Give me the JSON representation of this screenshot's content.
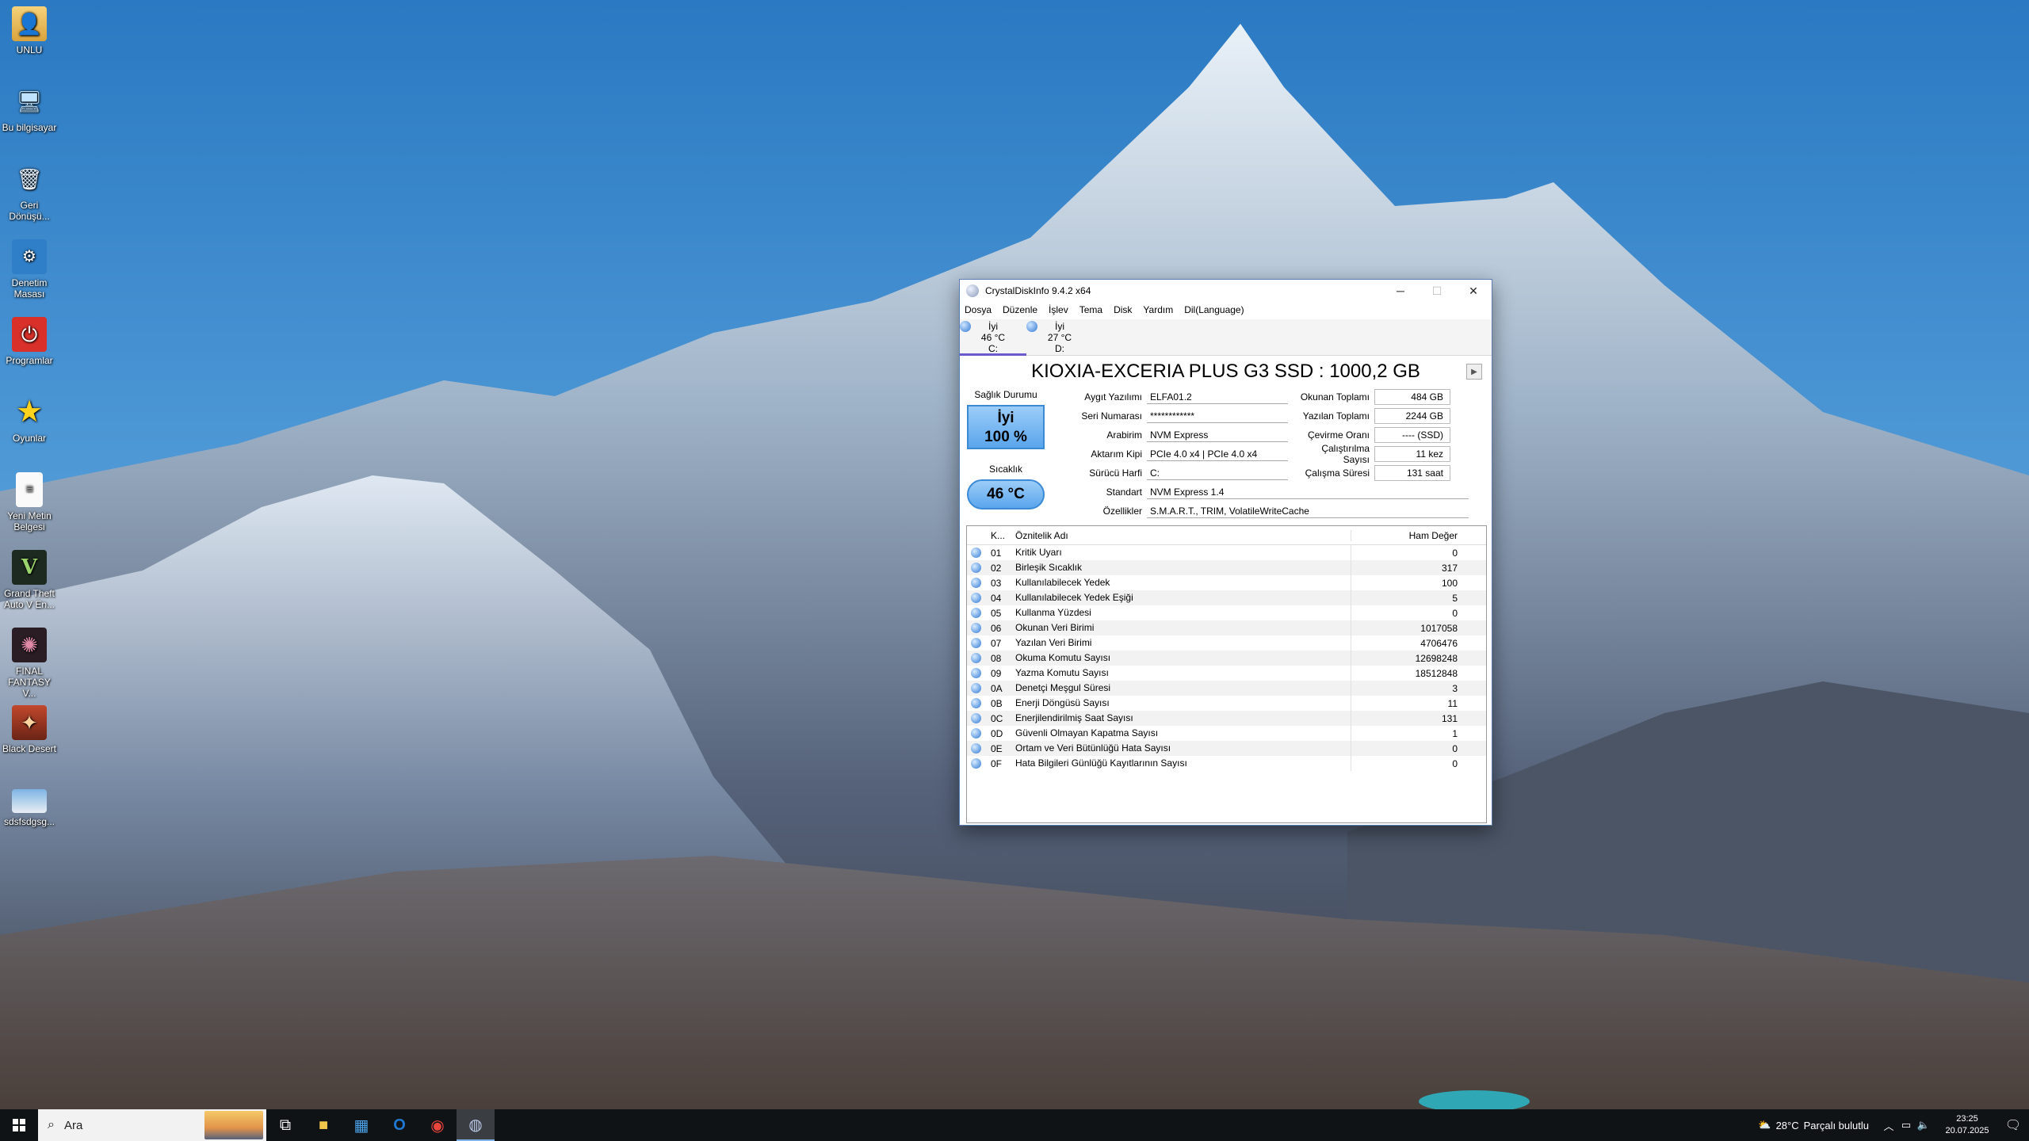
{
  "desktop": {
    "icons": [
      {
        "label": "UNLU",
        "icon": "user-folder-icon"
      },
      {
        "label": "Bu bilgisayar",
        "icon": "computer-icon"
      },
      {
        "label": "Geri Dönüşü...",
        "icon": "recycle-bin-icon"
      },
      {
        "label": "Denetim Masası",
        "icon": "control-panel-icon"
      },
      {
        "label": "Programlar",
        "icon": "power-icon"
      },
      {
        "label": "Oyunlar",
        "icon": "star-icon"
      },
      {
        "label": "Yeni Metin Belgesi",
        "icon": "text-document-icon"
      },
      {
        "label": "Grand Theft Auto V En...",
        "icon": "gta-v-icon"
      },
      {
        "label": "FINAL FANTASY V...",
        "icon": "final-fantasy-icon"
      },
      {
        "label": "Black Desert",
        "icon": "black-desert-icon"
      },
      {
        "label": "sdsfsdgsg...",
        "icon": "image-file-icon"
      }
    ]
  },
  "window": {
    "title": "CrystalDiskInfo 9.4.2 x64",
    "minimize": "─",
    "maximize": "☐",
    "close": "✕",
    "menu": [
      "Dosya",
      "Düzenle",
      "İşlev",
      "Tema",
      "Disk",
      "Yardım",
      "Dil(Language)"
    ],
    "disks": [
      {
        "status": "İyi",
        "temp": "46 °C",
        "letter": "C:"
      },
      {
        "status": "İyi",
        "temp": "27 °C",
        "letter": "D:"
      }
    ],
    "model": "KIOXIA-EXCERIA PLUS G3 SSD : 1000,2 GB",
    "next_arrow": "▶",
    "health": {
      "label": "Sağlık Durumu",
      "status": "İyi",
      "percent": "100 %"
    },
    "temperature": {
      "label": "Sıcaklık",
      "value": "46 °C"
    },
    "info": {
      "firmware": {
        "label": "Aygıt Yazılımı",
        "value": "ELFA01.2"
      },
      "serial": {
        "label": "Seri Numarası",
        "value": "************"
      },
      "interface": {
        "label": "Arabirim",
        "value": "NVM Express"
      },
      "transfer": {
        "label": "Aktarım Kipi",
        "value": "PCIe 4.0 x4 | PCIe 4.0 x4"
      },
      "drive_letter": {
        "label": "Sürücü Harfi",
        "value": "C:"
      },
      "standard": {
        "label": "Standart",
        "value": "NVM Express 1.4"
      },
      "features": {
        "label": "Özellikler",
        "value": "S.M.A.R.T., TRIM, VolatileWriteCache"
      },
      "host_reads": {
        "label": "Okunan Toplamı",
        "value": "484 GB"
      },
      "host_writes": {
        "label": "Yazılan Toplamı",
        "value": "2244 GB"
      },
      "rotation": {
        "label": "Çevirme Oranı",
        "value": "---- (SSD)"
      },
      "power_on_count": {
        "label": "Çalıştırılma Sayısı",
        "value": "11 kez"
      },
      "power_on_hours": {
        "label": "Çalışma Süresi",
        "value": "131 saat"
      }
    },
    "smart": {
      "columns": {
        "id": "K...",
        "name": "Öznitelik Adı",
        "raw": "Ham Değer"
      },
      "rows": [
        {
          "id": "01",
          "name": "Kritik Uyarı",
          "raw": "0"
        },
        {
          "id": "02",
          "name": "Birleşik Sıcaklık",
          "raw": "317"
        },
        {
          "id": "03",
          "name": "Kullanılabilecek Yedek",
          "raw": "100"
        },
        {
          "id": "04",
          "name": "Kullanılabilecek Yedek Eşiği",
          "raw": "5"
        },
        {
          "id": "05",
          "name": "Kullanma Yüzdesi",
          "raw": "0"
        },
        {
          "id": "06",
          "name": "Okunan Veri Birimi",
          "raw": "1017058"
        },
        {
          "id": "07",
          "name": "Yazılan Veri Birimi",
          "raw": "4706476"
        },
        {
          "id": "08",
          "name": "Okuma Komutu Sayısı",
          "raw": "12698248"
        },
        {
          "id": "09",
          "name": "Yazma Komutu Sayısı",
          "raw": "18512848"
        },
        {
          "id": "0A",
          "name": "Denetçi Meşgul Süresi",
          "raw": "3"
        },
        {
          "id": "0B",
          "name": "Enerji Döngüsü Sayısı",
          "raw": "11"
        },
        {
          "id": "0C",
          "name": "Enerjilendirilmiş Saat Sayısı",
          "raw": "131"
        },
        {
          "id": "0D",
          "name": "Güvenli Olmayan Kapatma Sayısı",
          "raw": "1"
        },
        {
          "id": "0E",
          "name": "Ortam ve Veri Bütünlüğü Hata Sayısı",
          "raw": "0"
        },
        {
          "id": "0F",
          "name": "Hata Bilgileri Günlüğü Kayıtlarının Sayısı",
          "raw": "0"
        }
      ]
    }
  },
  "taskbar": {
    "search_placeholder": "Ara",
    "weather_temp": "28°C",
    "weather_text": "Parçalı bulutlu",
    "time": "23:25",
    "date": "20.07.2025"
  },
  "colors": {
    "health_blue": "#5aa5ec",
    "status_dot": "#2f78d4",
    "taskbar": "#101316"
  }
}
